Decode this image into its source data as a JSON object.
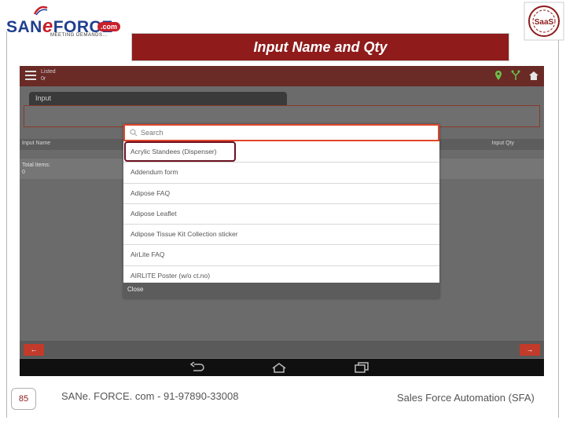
{
  "slide": {
    "title": "Input Name and Qty",
    "page_number": "85",
    "footer_left": "SANe. FORCE. com - 91-97890-33008",
    "footer_right": "Sales Force Automation (SFA)"
  },
  "logo": {
    "brand_san": "SAN",
    "brand_e": "e",
    "brand_force": "FORCE",
    "brand_com": ".com",
    "tagline": "MEETING DEMANDS...",
    "badge": "SaaS"
  },
  "app": {
    "listed_label": "Listed",
    "listed_value": "0r",
    "input_tab": "Input",
    "col_input_name": "Input Name",
    "col_input_qty": "Input Qty",
    "total_items_label": "Total Items:",
    "total_items_value": "0",
    "nav_prev": "←",
    "nav_next": "→"
  },
  "dialog": {
    "search_placeholder": "Search",
    "items": [
      "Acrylic Standees (Dispenser)",
      "Addendum form",
      "Adipose FAQ",
      "Adipose Leaflet",
      "Adipose Tissue Kit Collection sticker",
      "AirLite FAQ",
      "AIRLITE Poster (w/o ct.no)"
    ],
    "close_label": "Close"
  },
  "colors": {
    "brand_red": "#8f1b1b",
    "accent_orange": "#e0452a",
    "highlight_maroon": "#6b1020"
  }
}
